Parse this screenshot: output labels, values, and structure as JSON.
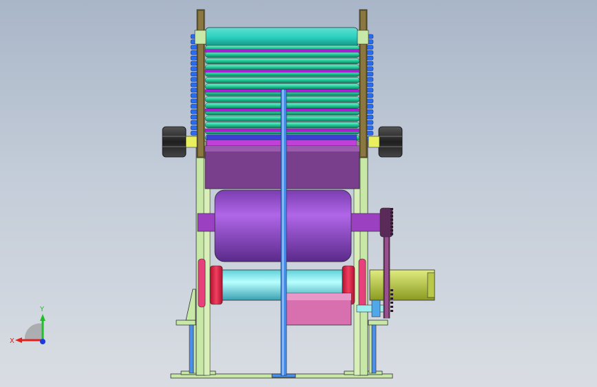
{
  "view": {
    "background_top": "#a9b6c8",
    "background_bottom": "#d9dde3"
  },
  "triad": {
    "x_label": "X",
    "y_label": "Y",
    "x_color": "#e0201c",
    "y_color": "#1fbf2a",
    "z_color": "#1b3be0"
  },
  "colors": {
    "frame": "#c8e8a8",
    "frame_edge": "#2b2b2b",
    "post": "#6b5a2a",
    "roller": "#2fd6a4",
    "roller_band": "#b020d8",
    "sprocket_blue": "#2a6cf0",
    "knob": "#3a3a3a",
    "hopper": "#7a3f8c",
    "drum": "#a855e0",
    "shaft": "#7fe8e8",
    "red_ring": "#e8204a",
    "motor": "#c8d860",
    "pink_block": "#d870b0",
    "gear": "#6a3060",
    "pole": "#4a90e8"
  }
}
